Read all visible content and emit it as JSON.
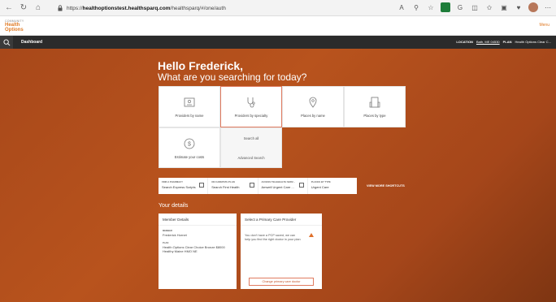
{
  "browser": {
    "url_prefix": "https://",
    "url_host": "healthoptionstest.healthsparq.com",
    "url_path": "/healthsparq/#/one/auth"
  },
  "site": {
    "logo_line1": "COMMUNITY",
    "logo_line2": "Health Options",
    "menu_label": "Menu"
  },
  "nav": {
    "dashboard_label": "Dashboard",
    "location_key": "LOCATION",
    "location_value": "Bath, ME 04530",
    "plan_key": "PLAN",
    "plan_value": "Health Options Clear C..."
  },
  "hero": {
    "greeting": "Hello Frederick,",
    "question": "What are you searching for today?"
  },
  "tiles": {
    "providers_by_name": "Providers by name",
    "providers_by_specialty": "Providers by specialty",
    "places_by_name": "Places by name",
    "places_by_type": "Places by type",
    "estimate_costs": "Estimate your costs",
    "search_all": "Search all",
    "advanced_search": "Advanced Search"
  },
  "shortcuts": [
    {
      "key": "FIND A PHARMACY",
      "value": "Search Express Scripts"
    },
    {
      "key": "ON CAREPATH PLAN",
      "value": "Search First Health"
    },
    {
      "key": "ACCESS TELEHEALTH SERV...",
      "value": "Amwell Urgent Care ..."
    },
    {
      "key": "PLACES BY TYPE",
      "value": "Urgent Care"
    }
  ],
  "view_more": "VIEW MORE SHORTCUTS",
  "details": {
    "title": "Your details",
    "member_card_title": "Member Details",
    "member_name_key": "MEMBER",
    "member_name": "Frederick Hornet",
    "plan_key": "PLAN",
    "plan_value": "Health Options Clear Choice Bronze $8000 Healthy Maine HMO NE",
    "pcp_card_title": "Select a Primary Care Provider",
    "pcp_text": "You don't have a PCP saved, we can help you find the right doctor in your plan",
    "pcp_button": "Change primary care doctor"
  },
  "colors": {
    "accent": "#e07b26",
    "hero_bg": "#b0501c",
    "nav_bg": "#2b2b2b"
  }
}
